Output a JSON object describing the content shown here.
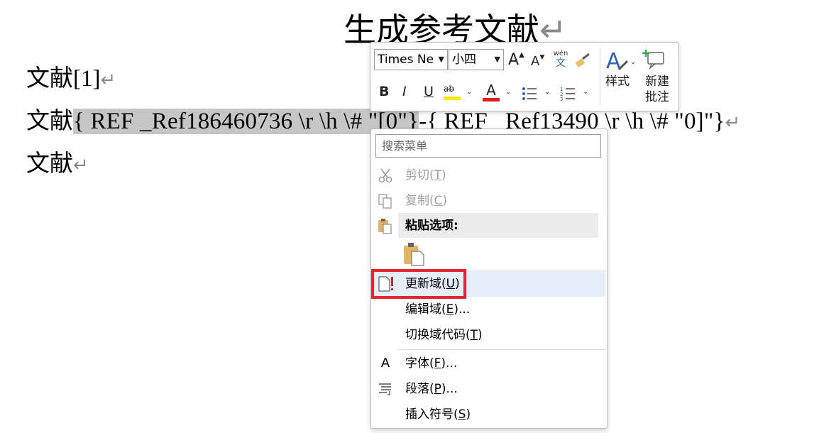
{
  "document": {
    "title": "生成参考文献",
    "lines": [
      {
        "prefix": "文献",
        "text": "[1]"
      },
      {
        "prefix": "文献",
        "field": "{ REF _Ref186460736 \\r \\h \\# \"[0\"}",
        "rest": "-{ REF _Ref13490 \\r \\h \\# \"0]\"}"
      },
      {
        "prefix": "文献"
      }
    ],
    "para_mark": "↵"
  },
  "mini_toolbar": {
    "font_name": "Times Ne",
    "font_size": "小四",
    "grow_font": "A",
    "shrink_font": "A",
    "phonetic_top": "wén",
    "phonetic_bottom": "文",
    "styles_label": "样式",
    "new_comment_line1": "新建",
    "new_comment_line2": "批注",
    "bold": "B",
    "italic": "I",
    "underline": "U",
    "highlight": "ab",
    "font_color": "A",
    "colors": {
      "highlight": "#f5e90a",
      "font_color": "#e0201b",
      "accent": "#2b62b8"
    }
  },
  "context_menu": {
    "search_placeholder": "搜索菜单",
    "cut": {
      "label": "剪切(",
      "key": "T",
      "tail": ")"
    },
    "copy": {
      "label": "复制(",
      "key": "C",
      "tail": ")"
    },
    "paste_options": "粘贴选项:",
    "update_field": {
      "label": "更新域(",
      "key": "U",
      "tail": ")"
    },
    "edit_field": {
      "label": "编辑域(",
      "key": "E",
      "tail": ")..."
    },
    "toggle_codes": {
      "label": "切换域代码(",
      "key": "T",
      "tail": ")"
    },
    "font": {
      "label": "字体(",
      "key": "F",
      "tail": ")..."
    },
    "paragraph": {
      "label": "段落(",
      "key": "P",
      "tail": ")..."
    },
    "insert_symbol": {
      "label": "插入符号(",
      "key": "S",
      "tail": ")"
    },
    "font_icon": "A"
  }
}
